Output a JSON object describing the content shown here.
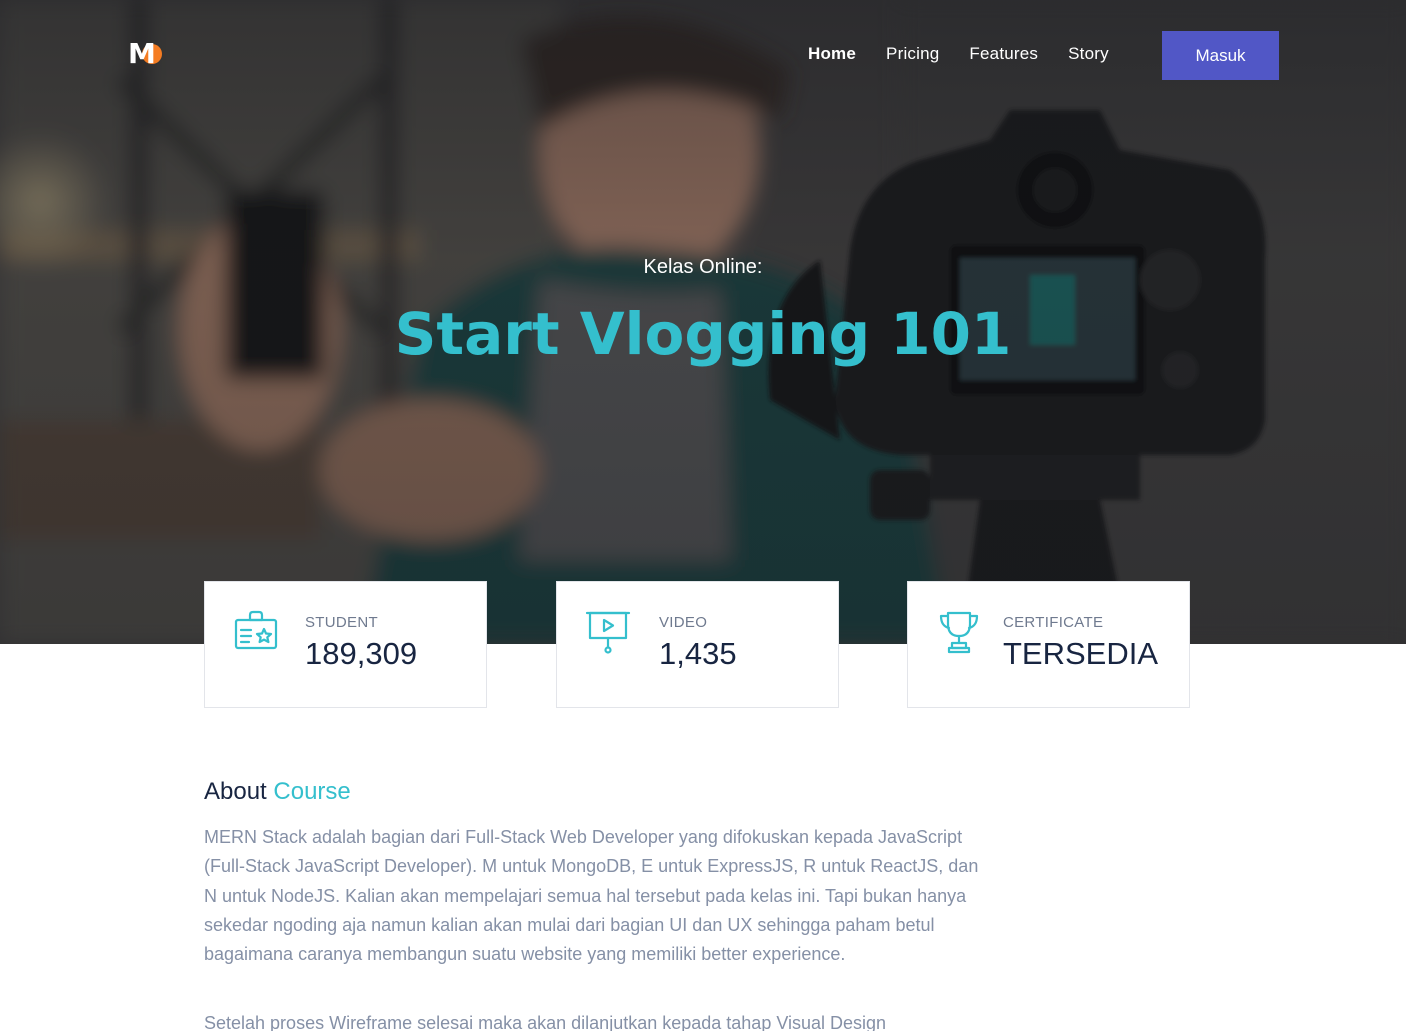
{
  "nav": {
    "logo_letter": "M",
    "links": [
      {
        "label": "Home",
        "active": true
      },
      {
        "label": "Pricing",
        "active": false
      },
      {
        "label": "Features",
        "active": false
      },
      {
        "label": "Story",
        "active": false
      }
    ],
    "cta_label": "Masuk"
  },
  "hero": {
    "subtitle": "Kelas Online:",
    "title": "Start Vlogging 101"
  },
  "stats": [
    {
      "label": "STUDENT",
      "value": "189,309",
      "icon": "student-card-icon"
    },
    {
      "label": "VIDEO",
      "value": "1,435",
      "icon": "video-presentation-icon"
    },
    {
      "label": "CERTIFICATE",
      "value": "TERSEDIA",
      "icon": "trophy-icon"
    }
  ],
  "about": {
    "title_first": "About",
    "title_accent": "Course",
    "paragraph1": "MERN Stack adalah bagian dari Full-Stack Web Developer yang difokuskan kepada JavaScript (Full-Stack JavaScript Developer). M untuk MongoDB, E untuk ExpressJS, R untuk ReactJS, dan N untuk NodeJS. Kalian akan mempelajari semua hal tersebut pada kelas ini. Tapi bukan hanya sekedar ngoding aja namun kalian akan mulai dari bagian UI dan UX sehingga paham betul bagaimana caranya membangun suatu website yang memiliki better experience.",
    "paragraph2": "Setelah proses Wireframe selesai maka akan dilanjutkan kepada tahap Visual Design"
  },
  "colors": {
    "accent": "#34bfcd",
    "button": "#5157c6",
    "heading": "#182541",
    "body_text": "#8590a6",
    "logo_orange": "#f57c22"
  }
}
